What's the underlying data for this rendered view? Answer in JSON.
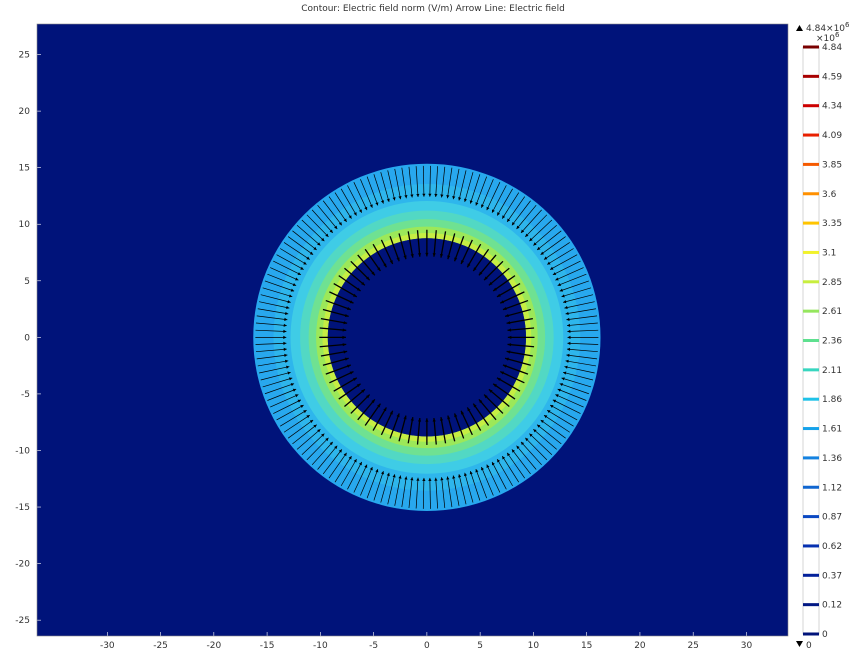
{
  "chart_data": {
    "type": "heatmap",
    "title": "Contour: Electric field norm (V/m)  Arrow Line: Electric field",
    "x_ticks": [
      "-30",
      "-25",
      "-20",
      "-15",
      "-10",
      "-5",
      "0",
      "5",
      "10",
      "15",
      "20",
      "25",
      "30"
    ],
    "y_ticks": [
      "25",
      "20",
      "15",
      "10",
      "5",
      "0",
      "-5",
      "-10",
      "-15",
      "-20",
      "-25"
    ],
    "xlim": [
      -36.6,
      33.9
    ],
    "ylim": [
      -26.4,
      27.7
    ],
    "grid": false,
    "ring": {
      "inner_radius": 9.3,
      "outer_radius": 16.3,
      "center": [
        0,
        0
      ]
    },
    "contours": [
      {
        "r": 9.3,
        "value": 3.1,
        "color": "#e9f03c"
      },
      {
        "r": 9.8,
        "value": 2.85,
        "color": "#c6ee43"
      },
      {
        "r": 10.4,
        "value": 2.61,
        "color": "#9ce859"
      },
      {
        "r": 11.1,
        "value": 2.36,
        "color": "#6fe192"
      },
      {
        "r": 11.9,
        "value": 2.11,
        "color": "#52d8c4"
      },
      {
        "r": 12.8,
        "value": 1.86,
        "color": "#3fcce6"
      },
      {
        "r": 14.4,
        "value": 1.61,
        "color": "#2eb6ec"
      }
    ],
    "colorbar": {
      "max_label": "4.84×10",
      "max_exp": "6",
      "multiplier": "×10",
      "multiplier_exp": "6",
      "min_label": "0",
      "levels": [
        {
          "label": "4.84",
          "value": 4.84,
          "color": "#7a0000"
        },
        {
          "label": "4.59",
          "value": 4.59,
          "color": "#a80000"
        },
        {
          "label": "4.34",
          "value": 4.34,
          "color": "#cc0000"
        },
        {
          "label": "4.09",
          "value": 4.09,
          "color": "#e82000"
        },
        {
          "label": "3.85",
          "value": 3.85,
          "color": "#f55a00"
        },
        {
          "label": "3.6",
          "value": 3.6,
          "color": "#ff9000"
        },
        {
          "label": "3.35",
          "value": 3.35,
          "color": "#ffc400"
        },
        {
          "label": "3.1",
          "value": 3.1,
          "color": "#f1f22c"
        },
        {
          "label": "2.85",
          "value": 2.85,
          "color": "#c8ee3e"
        },
        {
          "label": "2.61",
          "value": 2.61,
          "color": "#95e65e"
        },
        {
          "label": "2.36",
          "value": 2.36,
          "color": "#5ee08f"
        },
        {
          "label": "2.11",
          "value": 2.11,
          "color": "#37d6bf"
        },
        {
          "label": "1.86",
          "value": 1.86,
          "color": "#1fc2e8"
        },
        {
          "label": "1.61",
          "value": 1.61,
          "color": "#16a2ea"
        },
        {
          "label": "1.36",
          "value": 1.36,
          "color": "#1482e0"
        },
        {
          "label": "1.12",
          "value": 1.12,
          "color": "#1066d0"
        },
        {
          "label": "0.87",
          "value": 0.87,
          "color": "#0b48c2"
        },
        {
          "label": "0.62",
          "value": 0.62,
          "color": "#0630b0"
        },
        {
          "label": "0.37",
          "value": 0.37,
          "color": "#03209a"
        },
        {
          "label": "0.12",
          "value": 0.12,
          "color": "#021884"
        },
        {
          "label": "0",
          "value": 0,
          "color": "#00137a"
        }
      ]
    },
    "arrows": {
      "color": "#000000",
      "direction": "radially inward",
      "count_outer": 150,
      "count_inner": 72
    },
    "colors": {
      "background": "#00137a",
      "inner_hole": "#00137a",
      "outer_edge": "#28a8ee"
    }
  }
}
